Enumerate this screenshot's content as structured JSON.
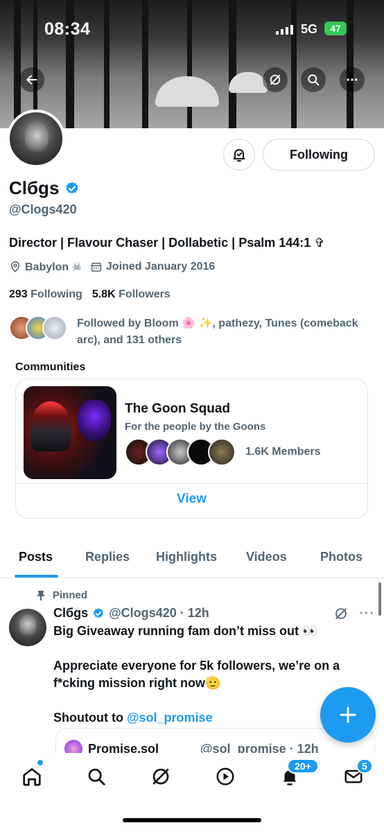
{
  "status_bar": {
    "time": "08:34",
    "network": "5G",
    "battery": "47"
  },
  "profile": {
    "name": "Clбgs",
    "handle": "@Clogs420",
    "bio": "Director | Flavour Chaser | Dollabetic | Psalm 144:1 ✞",
    "location": "Babylon ☠",
    "joined": "Joined January 2016",
    "following_count": "293",
    "following_label": "Following",
    "followers_count": "5.8K",
    "followers_label": "Followers",
    "followed_by": "Followed by Bloom 🌸 ✨, pathezy, Tunes (comeback arc), and 131 others",
    "follow_button": "Following"
  },
  "communities": {
    "title": "Communities",
    "name": "The Goon Squad",
    "description": "For the people by the Goons",
    "members": "1.6K Members",
    "view_label": "View"
  },
  "tabs": [
    "Posts",
    "Replies",
    "Highlights",
    "Videos",
    "Photos"
  ],
  "pinned_post": {
    "pinned_label": "Pinned",
    "author": "Clбgs",
    "handle_time": "@Clogs420 · 12h",
    "line1": "Big Giveaway running fam don’t miss out 👀",
    "line2": "Appreciate everyone for 5k followers, we’re on a f*cking mission right now🫡",
    "shoutout_prefix": "Shoutout to",
    "mention": "@sol_promise",
    "quote_name": "Promise.sol",
    "quote_handle": "@sol_promise · 12h"
  },
  "bottom_nav": {
    "notifications_badge": "20+",
    "messages_badge": "5"
  },
  "colors": {
    "accent": "#1d9bf0",
    "text": "#0f1419",
    "secondary": "#536471",
    "battery": "#34c759"
  }
}
